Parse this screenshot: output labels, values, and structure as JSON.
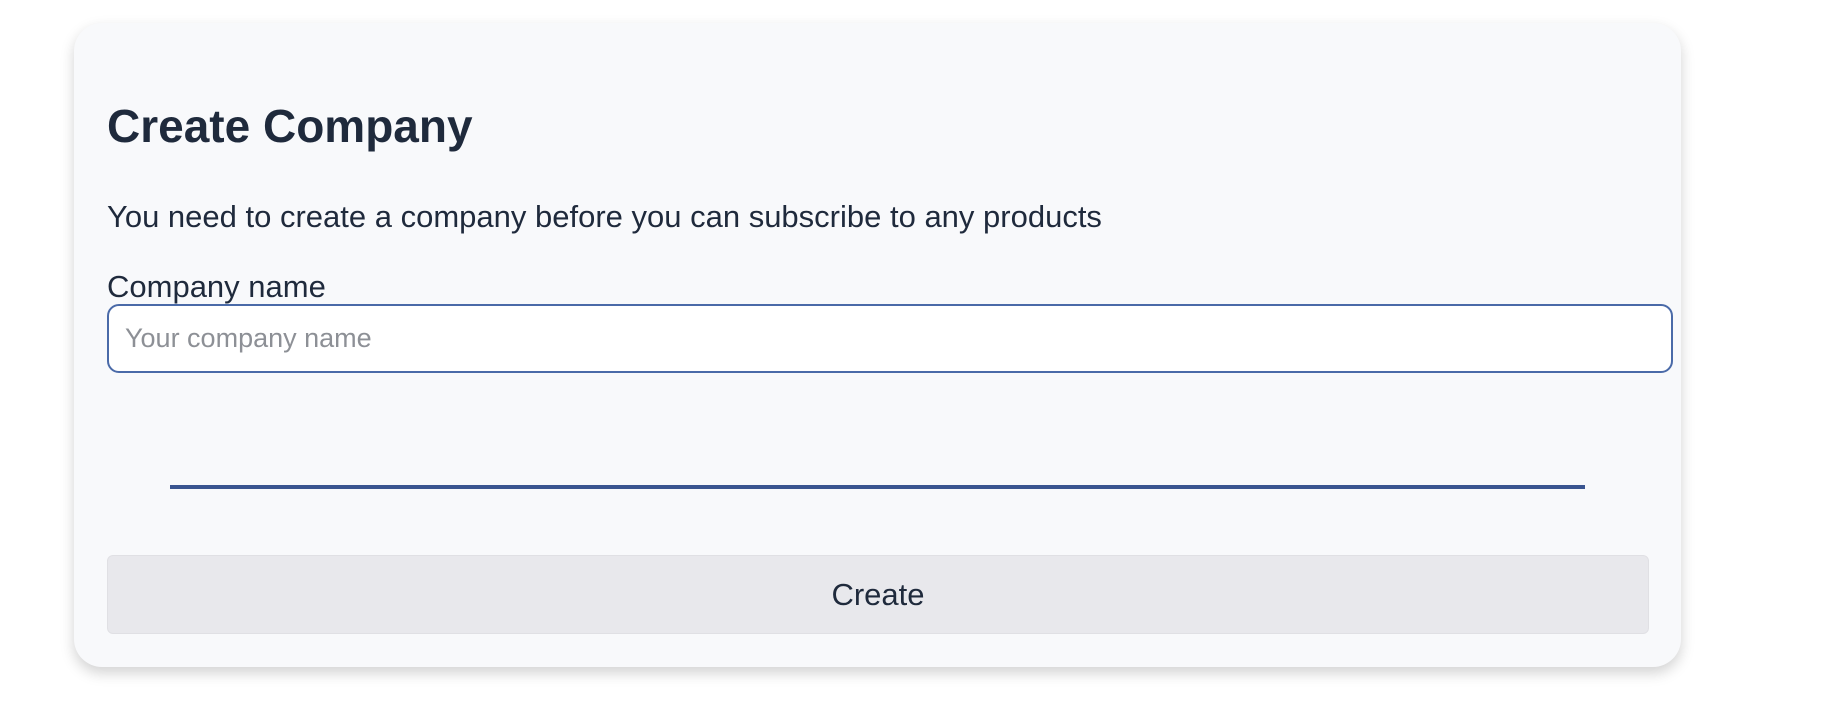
{
  "card": {
    "title": "Create Company",
    "description": "You need to create a company before you can subscribe to any products",
    "company_name_label": "Company name",
    "company_name_placeholder": "Your company name",
    "company_name_value": "",
    "create_label": "Create"
  },
  "colors": {
    "accent": "#3a5590",
    "text": "#1f2a3c",
    "card_bg": "#f8f9fb",
    "button_bg": "#e8e8ec"
  }
}
